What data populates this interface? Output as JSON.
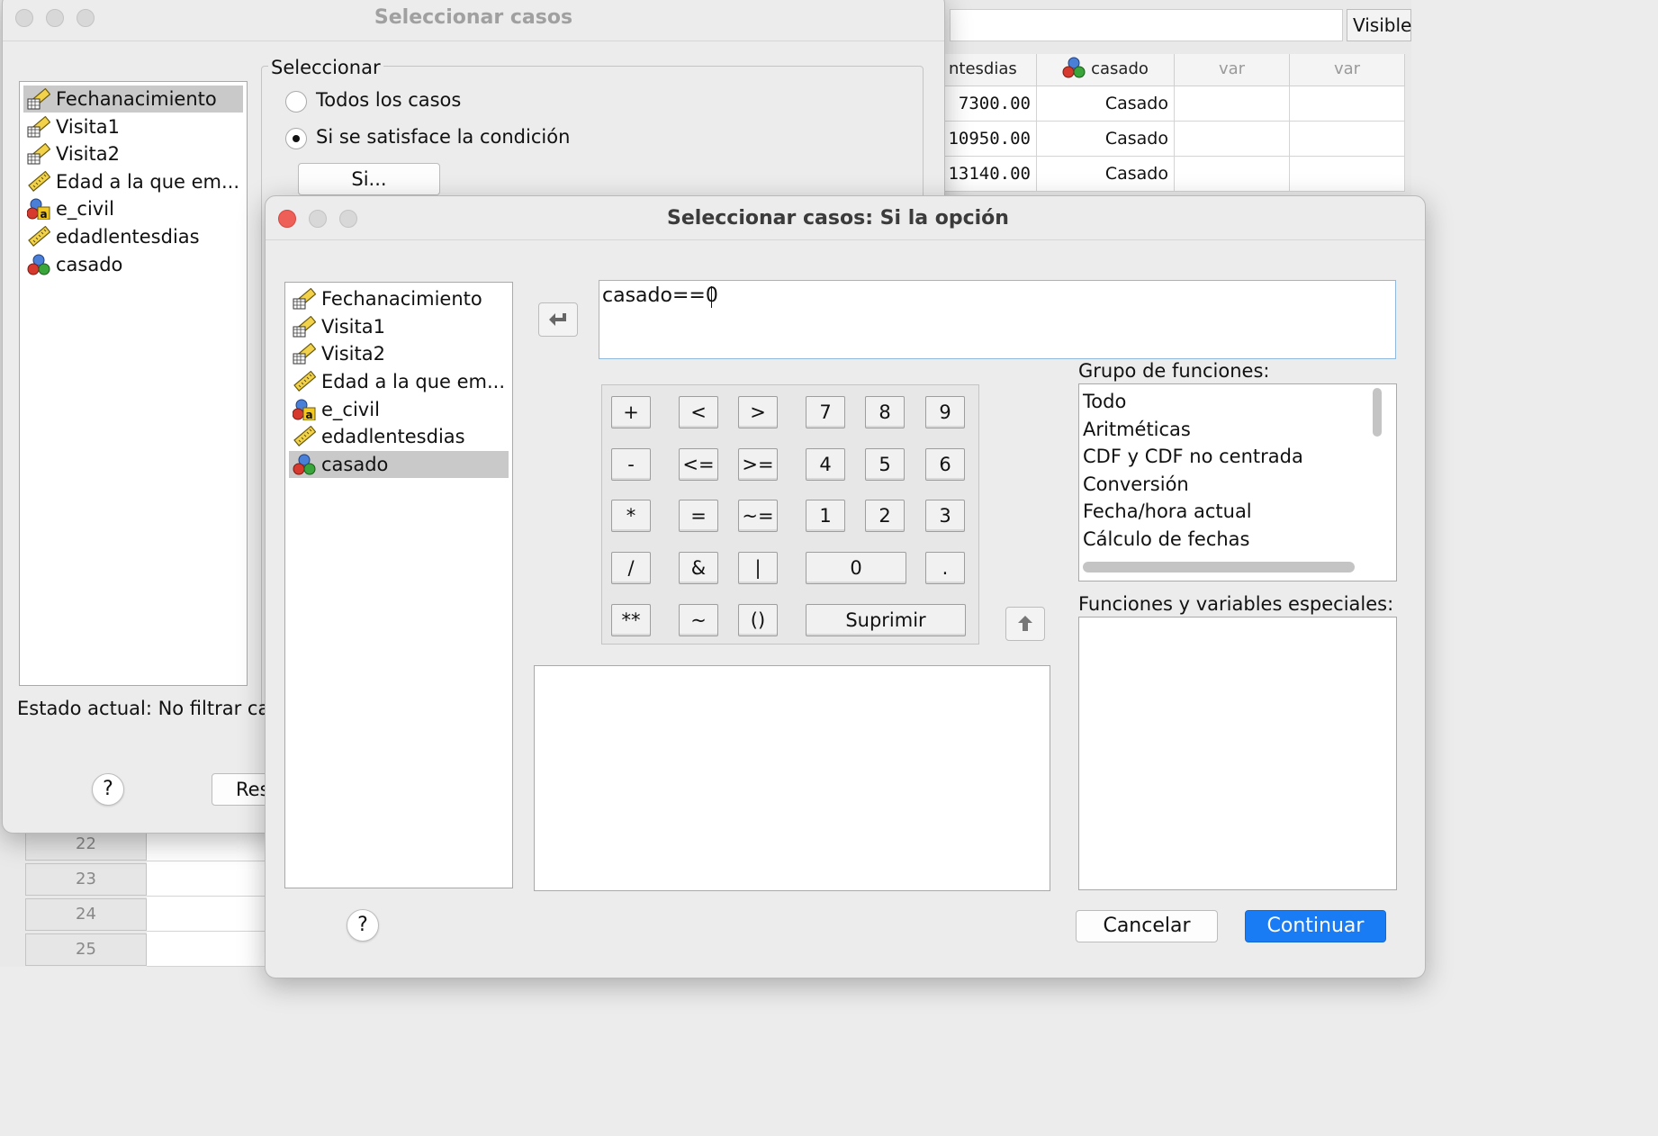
{
  "background_editor": {
    "visible_label": "Visible",
    "columns": [
      {
        "name": "ntesdias",
        "type": "text"
      },
      {
        "name": "casado",
        "type": "nominal"
      },
      {
        "name": "var",
        "type": "empty"
      },
      {
        "name": "var",
        "type": "empty"
      }
    ],
    "rows": [
      {
        "edadlentesdias": "7300.00",
        "casado": "Casado"
      },
      {
        "edadlentesdias": "10950.00",
        "casado": "Casado"
      },
      {
        "edadlentesdias": "13140.00",
        "casado": "Casado"
      }
    ],
    "row_numbers": [
      "22",
      "23",
      "24",
      "25"
    ]
  },
  "select_cases_dialog": {
    "title": "Seleccionar casos",
    "variables": [
      {
        "label": "Fechanacimiento",
        "icon": "date-ruler-icon",
        "selected": true
      },
      {
        "label": "Visita1",
        "icon": "date-ruler-icon"
      },
      {
        "label": "Visita2",
        "icon": "date-ruler-icon"
      },
      {
        "label": "Edad a la que em...",
        "icon": "ruler-scale-icon"
      },
      {
        "label": "e_civil",
        "icon": "nominal-string-icon"
      },
      {
        "label": "edadlentesdias",
        "icon": "ruler-scale-icon"
      },
      {
        "label": "casado",
        "icon": "nominal-icon"
      }
    ],
    "group_label": "Seleccionar",
    "option_all": "Todos los casos",
    "option_condition": "Si se satisface la condición",
    "if_button": "Si...",
    "status": "Estado actual: No filtrar ca",
    "reset_button_partial": "Res"
  },
  "if_dialog": {
    "title": "Seleccionar casos: Si la opción",
    "variables": [
      {
        "label": "Fechanacimiento",
        "icon": "date-ruler-icon"
      },
      {
        "label": "Visita1",
        "icon": "date-ruler-icon"
      },
      {
        "label": "Visita2",
        "icon": "date-ruler-icon"
      },
      {
        "label": "Edad a la que em...",
        "icon": "ruler-scale-icon"
      },
      {
        "label": "e_civil",
        "icon": "nominal-string-icon"
      },
      {
        "label": "edadlentesdias",
        "icon": "ruler-scale-icon"
      },
      {
        "label": "casado",
        "icon": "nominal-icon",
        "selected": true
      }
    ],
    "expression": "casado==0",
    "keypad": {
      "operators": [
        [
          "+",
          "<",
          ">"
        ],
        [
          "-",
          "<=",
          ">="
        ],
        [
          "*",
          "=",
          "~="
        ],
        [
          "/",
          "&",
          "|"
        ],
        [
          "**",
          "~",
          "()"
        ]
      ],
      "digits": [
        [
          "7",
          "8",
          "9"
        ],
        [
          "4",
          "5",
          "6"
        ],
        [
          "1",
          "2",
          "3"
        ]
      ],
      "zero": "0",
      "dot": ".",
      "delete": "Suprimir"
    },
    "function_group_label": "Grupo de funciones:",
    "function_groups": [
      "Todo",
      "Aritméticas",
      "CDF y CDF no centrada",
      "Conversión",
      "Fecha/hora actual",
      "Cálculo de fechas"
    ],
    "special_functions_label": "Funciones y variables especiales:",
    "cancel_button": "Cancelar",
    "continue_button": "Continuar",
    "help": "?"
  },
  "colors": {
    "accent": "#1a7cf5",
    "close_red": "#ee5f57",
    "selection": "#c9c9c9"
  }
}
